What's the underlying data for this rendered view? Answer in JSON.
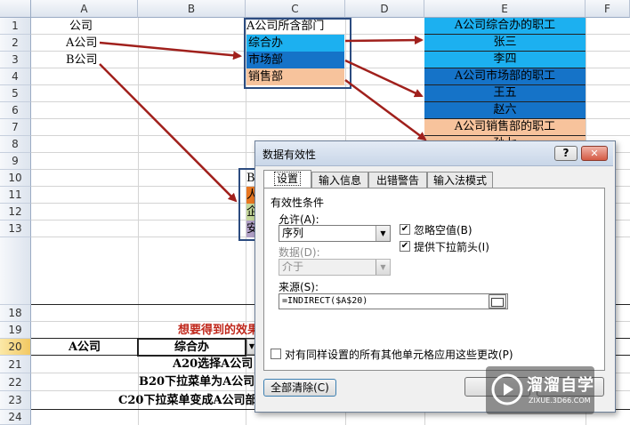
{
  "sheet": {
    "columns": [
      "A",
      "B",
      "C",
      "D",
      "E",
      "F"
    ],
    "rows": [
      "1",
      "2",
      "3",
      "4",
      "5",
      "6",
      "7",
      "8",
      "9",
      "10",
      "11",
      "12",
      "13",
      "",
      "18",
      "19",
      "20",
      "21",
      "22",
      "23",
      "24"
    ],
    "a_cells": [
      "公司",
      "A公司",
      "B公司"
    ],
    "c_cells": [
      "A公司所含部门",
      "综合办",
      "市场部",
      "销售部"
    ],
    "e_cells": [
      "A公司综合办的职工",
      "张三",
      "李四",
      "A公司市场部的职工",
      "王五",
      "赵六",
      "A公司销售部的职工",
      "孙七"
    ],
    "b_partial": [
      "B",
      "人",
      "企",
      "安"
    ],
    "row19_text": "想要得到的效果",
    "a20": "A公司",
    "b20": "综合办",
    "row21_text": "A20选择A公司",
    "row22_text": "B20下拉菜单为A公司的部门",
    "row23_text": "C20下拉菜单变成A公司部门的员工"
  },
  "dialog": {
    "title": "数据有效性",
    "help": "?",
    "close": "✕",
    "tabs": [
      "设置",
      "输入信息",
      "出错警告",
      "输入法模式"
    ],
    "group_label": "有效性条件",
    "allow_label": "允许(A):",
    "allow_value": "序列",
    "data_label": "数据(D):",
    "data_value": "介于",
    "ignore_blank_label": "忽略空值(B)",
    "dropdown_label": "提供下拉箭头(I)",
    "source_label": "来源(S):",
    "source_value": "=INDIRECT($A$20)",
    "apply_all_label": "对有同样设置的所有其他单元格应用这些更改(P)",
    "clear_all_label": "全部清除(C)"
  },
  "watermark": {
    "brand": "溜溜自学",
    "url": "ZIXUE.3D66.COM"
  },
  "colors": {
    "arrow": "#a0201c",
    "light_blue": "#1cb0f0",
    "dark_blue": "#1573c8",
    "salmon": "#f7c39c"
  }
}
